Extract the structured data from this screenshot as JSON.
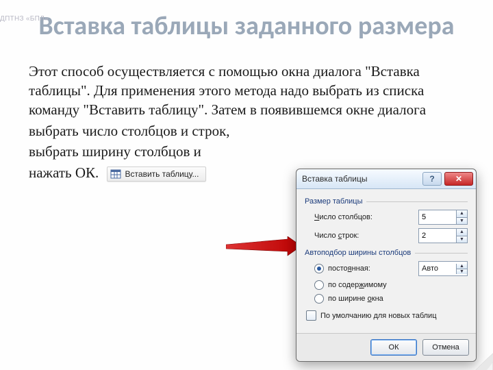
{
  "watermark": "ДПТНЗ «БПЛ»",
  "title": "Вставка таблицы заданного размера",
  "paragraph": "Этот способ осуществляется с помощью окна диалога \"Вставка таблицы\". Для применения этого метода надо выбрать из списка команду \"Вставить таблицу\". Затем в появившемся окне диалога",
  "line2": "выбрать число столбцов и строк,",
  "line3": "выбрать ширину столбцов и",
  "line4": "нажать ОК.",
  "menu_item": "Вставить таблицу...",
  "dialog": {
    "title": "Вставка таблицы",
    "group_size": "Размер таблицы",
    "cols_label_pre": "Ч",
    "cols_label_rest": "исло столбцов:",
    "rows_label_pre": "Число ",
    "rows_label_underline": "с",
    "rows_label_rest": "трок:",
    "cols_value": "5",
    "rows_value": "2",
    "group_autofit": "Автоподбор ширины столбцов",
    "opt_fixed_pre": "посто",
    "opt_fixed_u": "я",
    "opt_fixed_rest": "нная:",
    "opt_content": "по содер",
    "opt_content_u": "ж",
    "opt_content_rest": "имому",
    "opt_window_pre": "по ширине ",
    "opt_window_u": "о",
    "opt_window_rest": "кна",
    "fixed_value": "Авто",
    "remember": "По умолчанию для новых таблиц",
    "ok": "ОК",
    "cancel": "Отмена"
  }
}
